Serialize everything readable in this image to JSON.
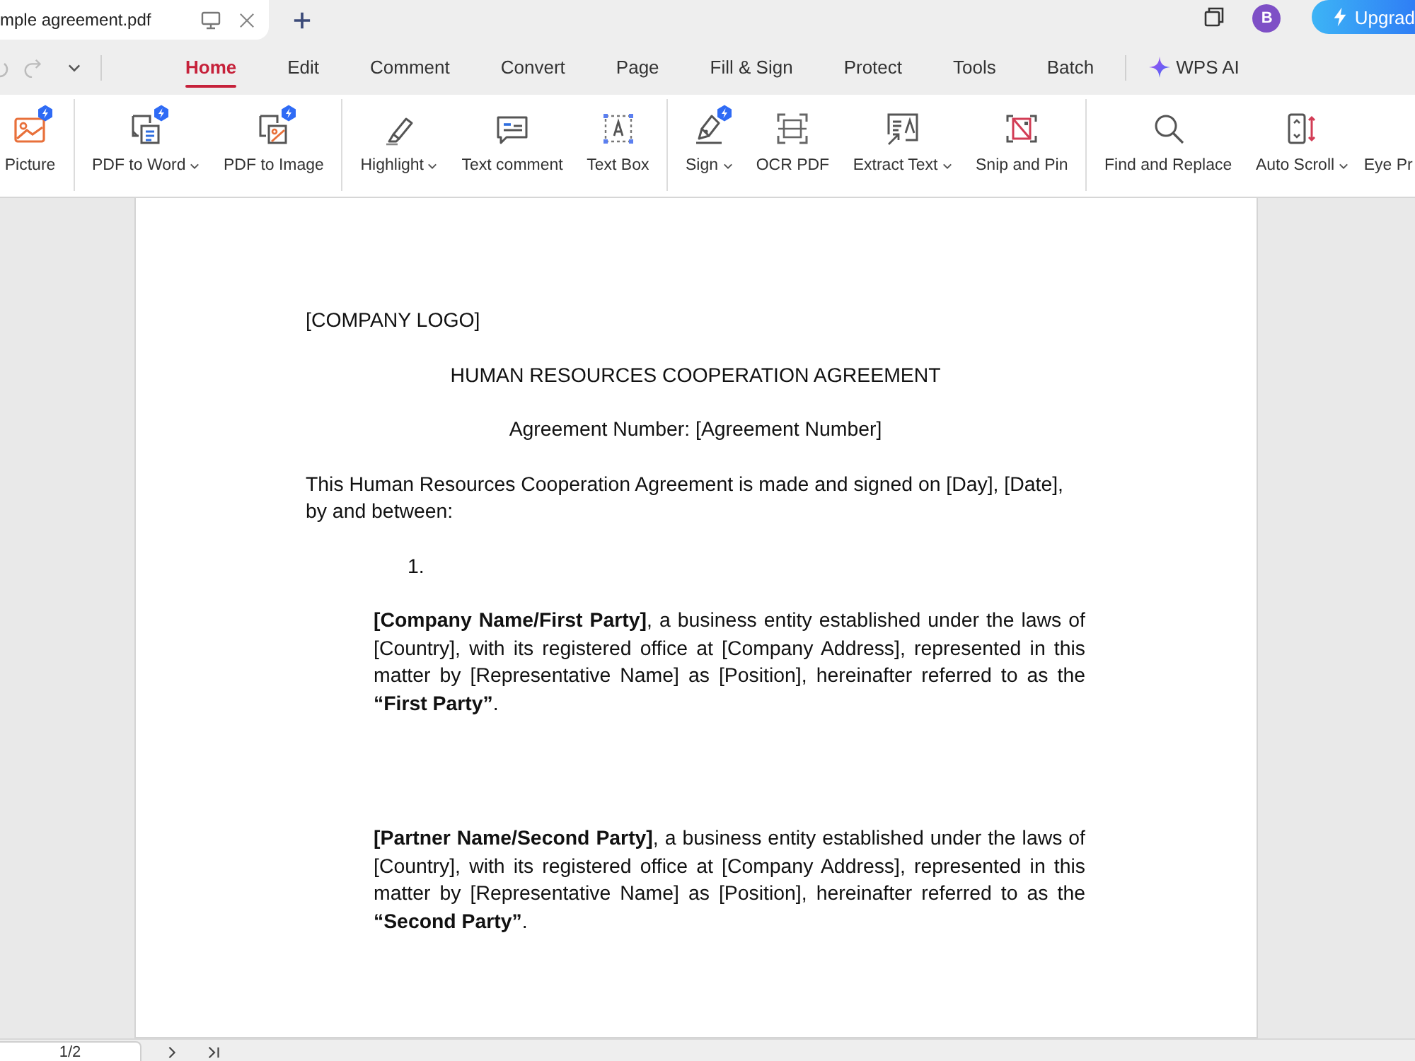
{
  "document_tabs": [
    {
      "title": "mple agreement.pdf",
      "selected": true
    }
  ],
  "account": {
    "avatar_letter": "B",
    "upgrade_label": "Upgrad"
  },
  "menu_tabs": [
    {
      "label": "Home",
      "selected": true
    },
    {
      "label": "Edit",
      "selected": false
    },
    {
      "label": "Comment",
      "selected": false
    },
    {
      "label": "Convert",
      "selected": false
    },
    {
      "label": "Page",
      "selected": false
    },
    {
      "label": "Fill & Sign",
      "selected": false
    },
    {
      "label": "Protect",
      "selected": false
    },
    {
      "label": "Tools",
      "selected": false
    },
    {
      "label": "Batch",
      "selected": false
    }
  ],
  "ai_button": {
    "label": "WPS AI"
  },
  "ribbon": [
    {
      "tools": [
        {
          "label": "Picture",
          "dropdown": false,
          "badge": true
        }
      ]
    },
    {
      "tools": [
        {
          "label": "PDF to Word",
          "dropdown": true,
          "badge": true
        },
        {
          "label": "PDF to Image",
          "dropdown": false,
          "badge": true
        }
      ]
    },
    {
      "tools": [
        {
          "label": "Highlight",
          "dropdown": true,
          "badge": false
        },
        {
          "label": "Text comment",
          "dropdown": false,
          "badge": false
        },
        {
          "label": "Text Box",
          "dropdown": false,
          "badge": false
        }
      ]
    },
    {
      "tools": [
        {
          "label": "Sign",
          "dropdown": true,
          "badge": true
        },
        {
          "label": "OCR PDF",
          "dropdown": false,
          "badge": false
        },
        {
          "label": "Extract Text",
          "dropdown": true,
          "badge": false
        },
        {
          "label": "Snip and Pin",
          "dropdown": false,
          "badge": false
        }
      ]
    },
    {
      "tools": [
        {
          "label": "Find and Replace",
          "dropdown": false,
          "badge": false
        },
        {
          "label": "Auto Scroll",
          "dropdown": true,
          "badge": false
        },
        {
          "label": "Eye Pr",
          "dropdown": false,
          "badge": false
        }
      ]
    }
  ],
  "document": {
    "blocks": [
      {
        "kind": "plain",
        "text": "[COMPANY LOGO]"
      },
      {
        "kind": "heading",
        "text": "HUMAN RESOURCES COOPERATION AGREEMENT"
      },
      {
        "kind": "heading",
        "text": "Agreement Number: [Agreement Number]"
      },
      {
        "kind": "plain",
        "text": "This Human Resources Cooperation Agreement is made and signed on [Day], [Date], by and between:"
      },
      {
        "kind": "number",
        "text": "1."
      },
      {
        "kind": "party",
        "text": "**[Company Name/First Party]**, a business entity established under the laws of [Country], with its registered office at [Company Address], represented in this matter by [Representative Name] as [Position], hereinafter referred to as the **“First Party”**."
      },
      {
        "kind": "party",
        "text": "**[Partner Name/Second Party]**, a business entity established under the laws of [Country], with its registered office at [Company Address], represented in this matter by [Representative Name] as [Position], hereinafter referred to as the **“Second Party”**."
      }
    ]
  },
  "status_bar": {
    "page_indicator": "1/2"
  }
}
